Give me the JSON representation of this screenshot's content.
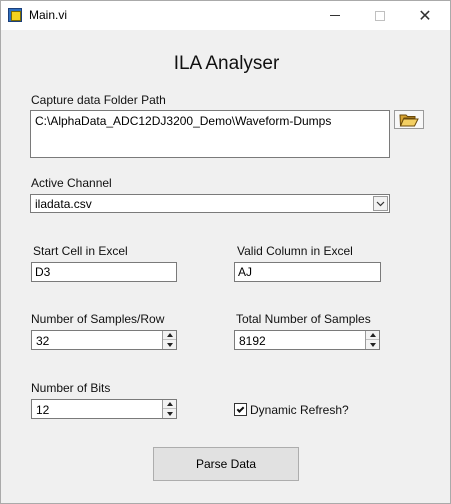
{
  "window": {
    "title": "Main.vi",
    "icon": "labview-vi-icon",
    "controls": {
      "minimize": "minimize-icon",
      "maximize": "maximize-icon",
      "close": "close-icon",
      "close_glyph": "✕"
    }
  },
  "heading": "ILA Analyser",
  "capture_path": {
    "label": "Capture data Folder Path",
    "value": "C:\\AlphaData_ADC12DJ3200_Demo\\Waveform-Dumps",
    "browse_icon": "folder-open-icon"
  },
  "active_channel": {
    "label": "Active Channel",
    "selected": "iladata.csv"
  },
  "start_cell": {
    "label": "Start Cell in Excel",
    "value": "D3"
  },
  "valid_column": {
    "label": "Valid Column in Excel",
    "value": "AJ"
  },
  "samples_per_row": {
    "label": "Number of Samples/Row",
    "value": "32"
  },
  "total_samples": {
    "label": "Total Number of Samples",
    "value": "8192"
  },
  "num_bits": {
    "label": "Number of Bits",
    "value": "12"
  },
  "dynamic_refresh": {
    "label": "Dynamic Refresh?",
    "checked": true
  },
  "parse_button": {
    "label": "Parse Data"
  }
}
